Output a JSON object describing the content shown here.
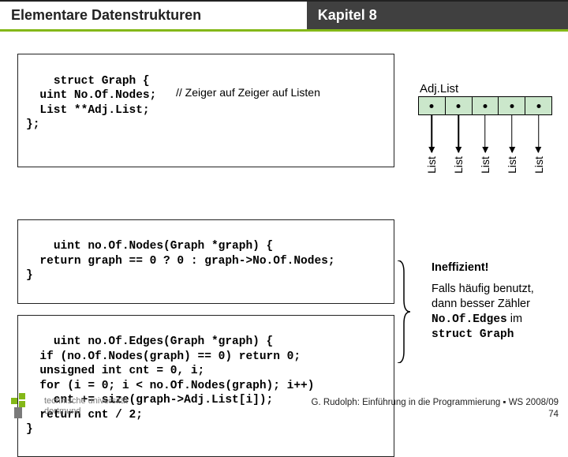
{
  "header": {
    "left": "Elementare Datenstrukturen",
    "right": "Kapitel 8"
  },
  "code": {
    "struct": "struct Graph {\n  uint No.Of.Nodes;\n  List **Adj.List;\n};",
    "struct_comment": "// Zeiger auf Zeiger auf Listen",
    "fn1": "uint no.Of.Nodes(Graph *graph) {\n  return graph == 0 ? 0 : graph->No.Of.Nodes;\n}",
    "fn2": "uint no.Of.Edges(Graph *graph) {\n  if (no.Of.Nodes(graph) == 0) return 0;\n  unsigned int cnt = 0, i;\n  for (i = 0; i < no.Of.Nodes(graph); i++)\n    cnt += size(graph->Adj.List[i]);\n  return cnt / 2;\n}"
  },
  "adjlist": {
    "title": "Adj.List",
    "cells": [
      {
        "label": "List"
      },
      {
        "label": "List"
      },
      {
        "label": "List"
      },
      {
        "label": "List"
      },
      {
        "label": "List"
      }
    ]
  },
  "side": {
    "ineff": "Ineffizient!",
    "note_pre": "Falls häufig benutzt, dann besser Zähler ",
    "note_mono1": "No.Of.Edges",
    "note_mid": " im ",
    "note_mono2": "struct Graph"
  },
  "footer": {
    "line1": "G. Rudolph: Einführung in die Programmierung ▪ WS 2008/09",
    "page": "74"
  },
  "logo": {
    "l1": "technische universität",
    "l2": "dortmund"
  }
}
